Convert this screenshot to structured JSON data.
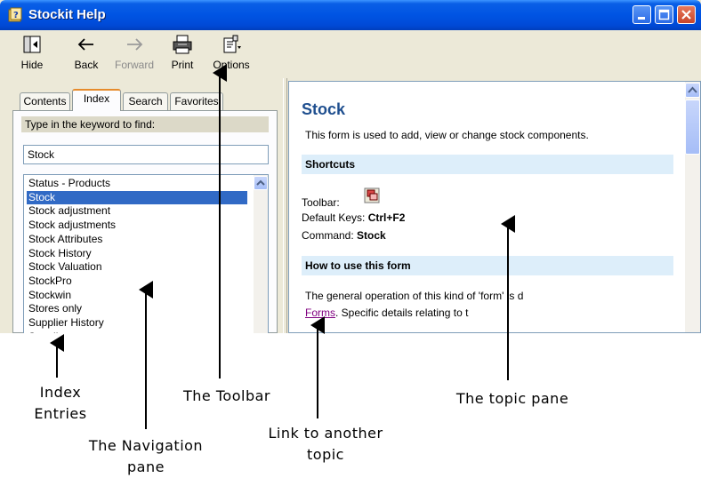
{
  "window": {
    "title": "Stockit Help",
    "buttons": [
      "minimize",
      "maximize",
      "close"
    ]
  },
  "toolbar": {
    "hide": "Hide",
    "back": "Back",
    "forward": "Forward",
    "print": "Print",
    "options": "Options"
  },
  "nav": {
    "tabs": [
      "Contents",
      "Index",
      "Search",
      "Favorites"
    ],
    "active_tab": "Index",
    "keyword_label": "Type in the keyword to find:",
    "keyword_value": "Stock",
    "entries": [
      "Status - Products",
      "Stock",
      "Stock adjustment",
      "Stock adjustments",
      "Stock Attributes",
      "Stock History",
      "Stock Valuation",
      "StockPro",
      "Stockwin",
      "Stores only",
      "Supplier History",
      "Suppliers"
    ],
    "selected_entry": "Stock"
  },
  "topic": {
    "title": "Stock",
    "intro": "This form is used to add, view or change stock components.",
    "shortcuts_heading": "Shortcuts",
    "toolbar_label": "Toolbar:",
    "default_keys_label": "Default Keys:",
    "default_keys_value": "Ctrl+F2",
    "command_label": "Command:",
    "command_value": "Stock",
    "how_heading": "How to use this form",
    "para_start": "The general operation of this kind of 'form' is d",
    "link_text": "Forms",
    "para_end": ". Specific details relating to t"
  },
  "annotations": {
    "index_entries": [
      "Index",
      "Entries"
    ],
    "toolbar": "The Toolbar",
    "navigation_pane": [
      "The Navigation",
      "pane"
    ],
    "link": [
      "Link to another",
      "topic"
    ],
    "topic_pane": "The topic pane"
  },
  "colors": {
    "title_bar": "#0054e3",
    "selection": "#316ac5",
    "topic_title": "#1f4f8f",
    "section_band": "#ddeefa",
    "link": "#800080"
  }
}
